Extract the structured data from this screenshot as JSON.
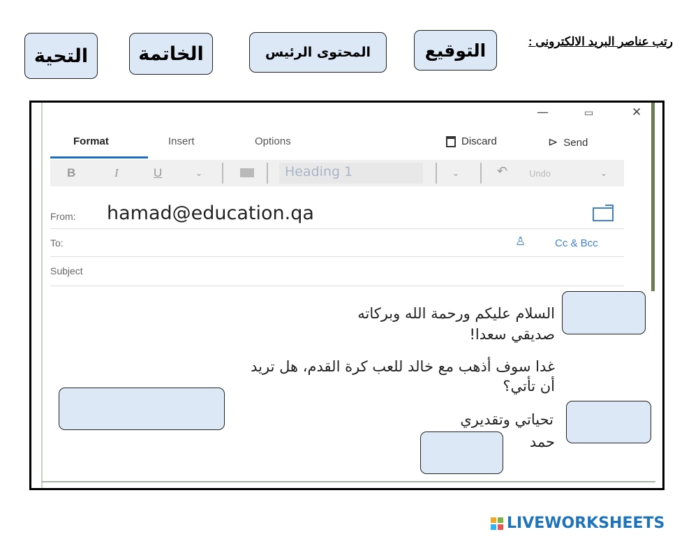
{
  "instruction": "رتب عناصر البريد الالكترونى :",
  "chips": {
    "signature": "التوقيع",
    "main_content": "المحتوى الرئيس",
    "closing": "الخاتمة",
    "greeting": "التحية"
  },
  "window_controls": {
    "minimize": "—",
    "maximize": "▭",
    "close": "✕"
  },
  "tabs": {
    "format": "Format",
    "insert": "Insert",
    "options": "Options"
  },
  "toolbar": {
    "discard": "Discard",
    "send": "Send"
  },
  "format_bar": {
    "bold": "B",
    "italic": "I",
    "underline": "U",
    "style": "Heading 1",
    "undo_icon": "↶",
    "undo": "Undo",
    "chevron": "⌄"
  },
  "fields": {
    "from_label": "From:",
    "from_value": "hamad@education.qa",
    "to_label": "To:",
    "cc_bcc": "Cc & Bcc",
    "subject_label": "Subject"
  },
  "email_body": {
    "greeting_line1": "السلام عليكم ورحمة الله وبركاته",
    "greeting_line2": "صديقي سعدا!",
    "main_line1": "غدا سوف أذهب مع خالد للعب كرة القدم، هل تريد",
    "main_line2": "أن تأتي؟",
    "closing_line": "تحياتي وتقديري",
    "signature_line": "حمد"
  },
  "brand": {
    "name": "LIVEWORKSHEETS"
  },
  "colors": {
    "chip_fill": "#dce8f5",
    "accent_blue": "#1f74b9",
    "logo_colors": [
      "#f5a623",
      "#7cb342",
      "#29b6f6",
      "#ef5350"
    ]
  }
}
